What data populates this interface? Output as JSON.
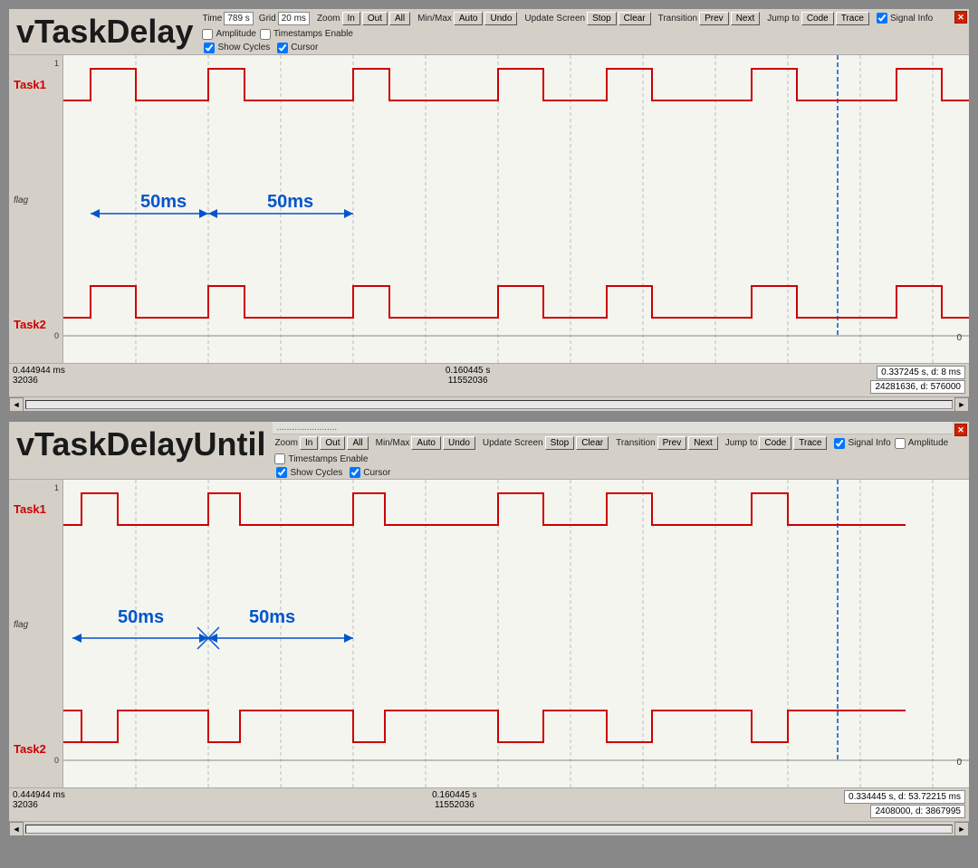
{
  "window1": {
    "title": "vTaskDelay",
    "time_label": "Time",
    "time_value": "789 s",
    "grid_label": "Grid",
    "grid_value": "20 ms",
    "zoom_label": "Zoom",
    "zoom_in": "In",
    "zoom_out": "Out",
    "zoom_all": "All",
    "minmax_label": "Min/Max",
    "minmax_auto": "Auto",
    "minmax_undo": "Undo",
    "update_label": "Update Screen",
    "update_stop": "Stop",
    "update_clear": "Clear",
    "transition_label": "Transition",
    "transition_prev": "Prev",
    "transition_next": "Next",
    "jumpto_label": "Jump to",
    "jumpto_code": "Code",
    "jumpto_trace": "Trace",
    "signal_info_label": "Signal Info",
    "signal_info_checked": true,
    "amplitude_label": "Amplitude",
    "amplitude_checked": false,
    "timestamps_label": "Timestamps Enable",
    "timestamps_checked": false,
    "show_cycles_label": "Show Cycles",
    "show_cycles_checked": true,
    "cursor_label": "Cursor",
    "cursor_checked": true,
    "task1_label": "Task1",
    "task2_label": "Task2",
    "flag_label": "flag",
    "meas1_label": "50ms",
    "meas2_label": "50ms",
    "status_left_1": "0.444944 ms",
    "status_left_2": "32036",
    "status_center_1": "0.160445 s",
    "status_center_2": "11552036",
    "status_right_1": "0.337245 s,  d: 8 ms",
    "status_right_2": "24281636,  d: 576000"
  },
  "window2": {
    "title": "vTaskDelayUntil",
    "zoom_label": "Zoom",
    "zoom_in": "In",
    "zoom_out": "Out",
    "zoom_all": "All",
    "minmax_label": "Min/Max",
    "minmax_auto": "Auto",
    "minmax_undo": "Undo",
    "update_label": "Update Screen",
    "update_stop": "Stop",
    "update_clear": "Clear",
    "transition_label": "Transition",
    "transition_prev": "Prev",
    "transition_next": "Next",
    "jumpto_label": "Jump to",
    "jumpto_code": "Code",
    "jumpto_trace": "Trace",
    "signal_info_label": "Signal Info",
    "signal_info_checked": true,
    "amplitude_label": "Amplitude",
    "amplitude_checked": false,
    "timestamps_label": "Timestamps Enable",
    "timestamps_checked": false,
    "show_cycles_label": "Show Cycles",
    "show_cycles_checked": true,
    "cursor_label": "Cursor",
    "cursor_checked": true,
    "task1_label": "Task1",
    "task2_label": "Task2",
    "flag_label": "flag",
    "meas1_label": "50ms",
    "meas2_label": "50ms",
    "status_left_1": "0.444944 ms",
    "status_left_2": "32036",
    "status_center_1": "0.160445 s",
    "status_center_2": "11552036",
    "status_right_1": "0.334445 s,  d: 53.72215 ms",
    "status_right_2": "2408000,  d: 3867995"
  },
  "ui": {
    "close_icon": "✕",
    "scroll_left": "◄",
    "scroll_right": "►",
    "scale_1": "1",
    "scale_0": "0"
  }
}
